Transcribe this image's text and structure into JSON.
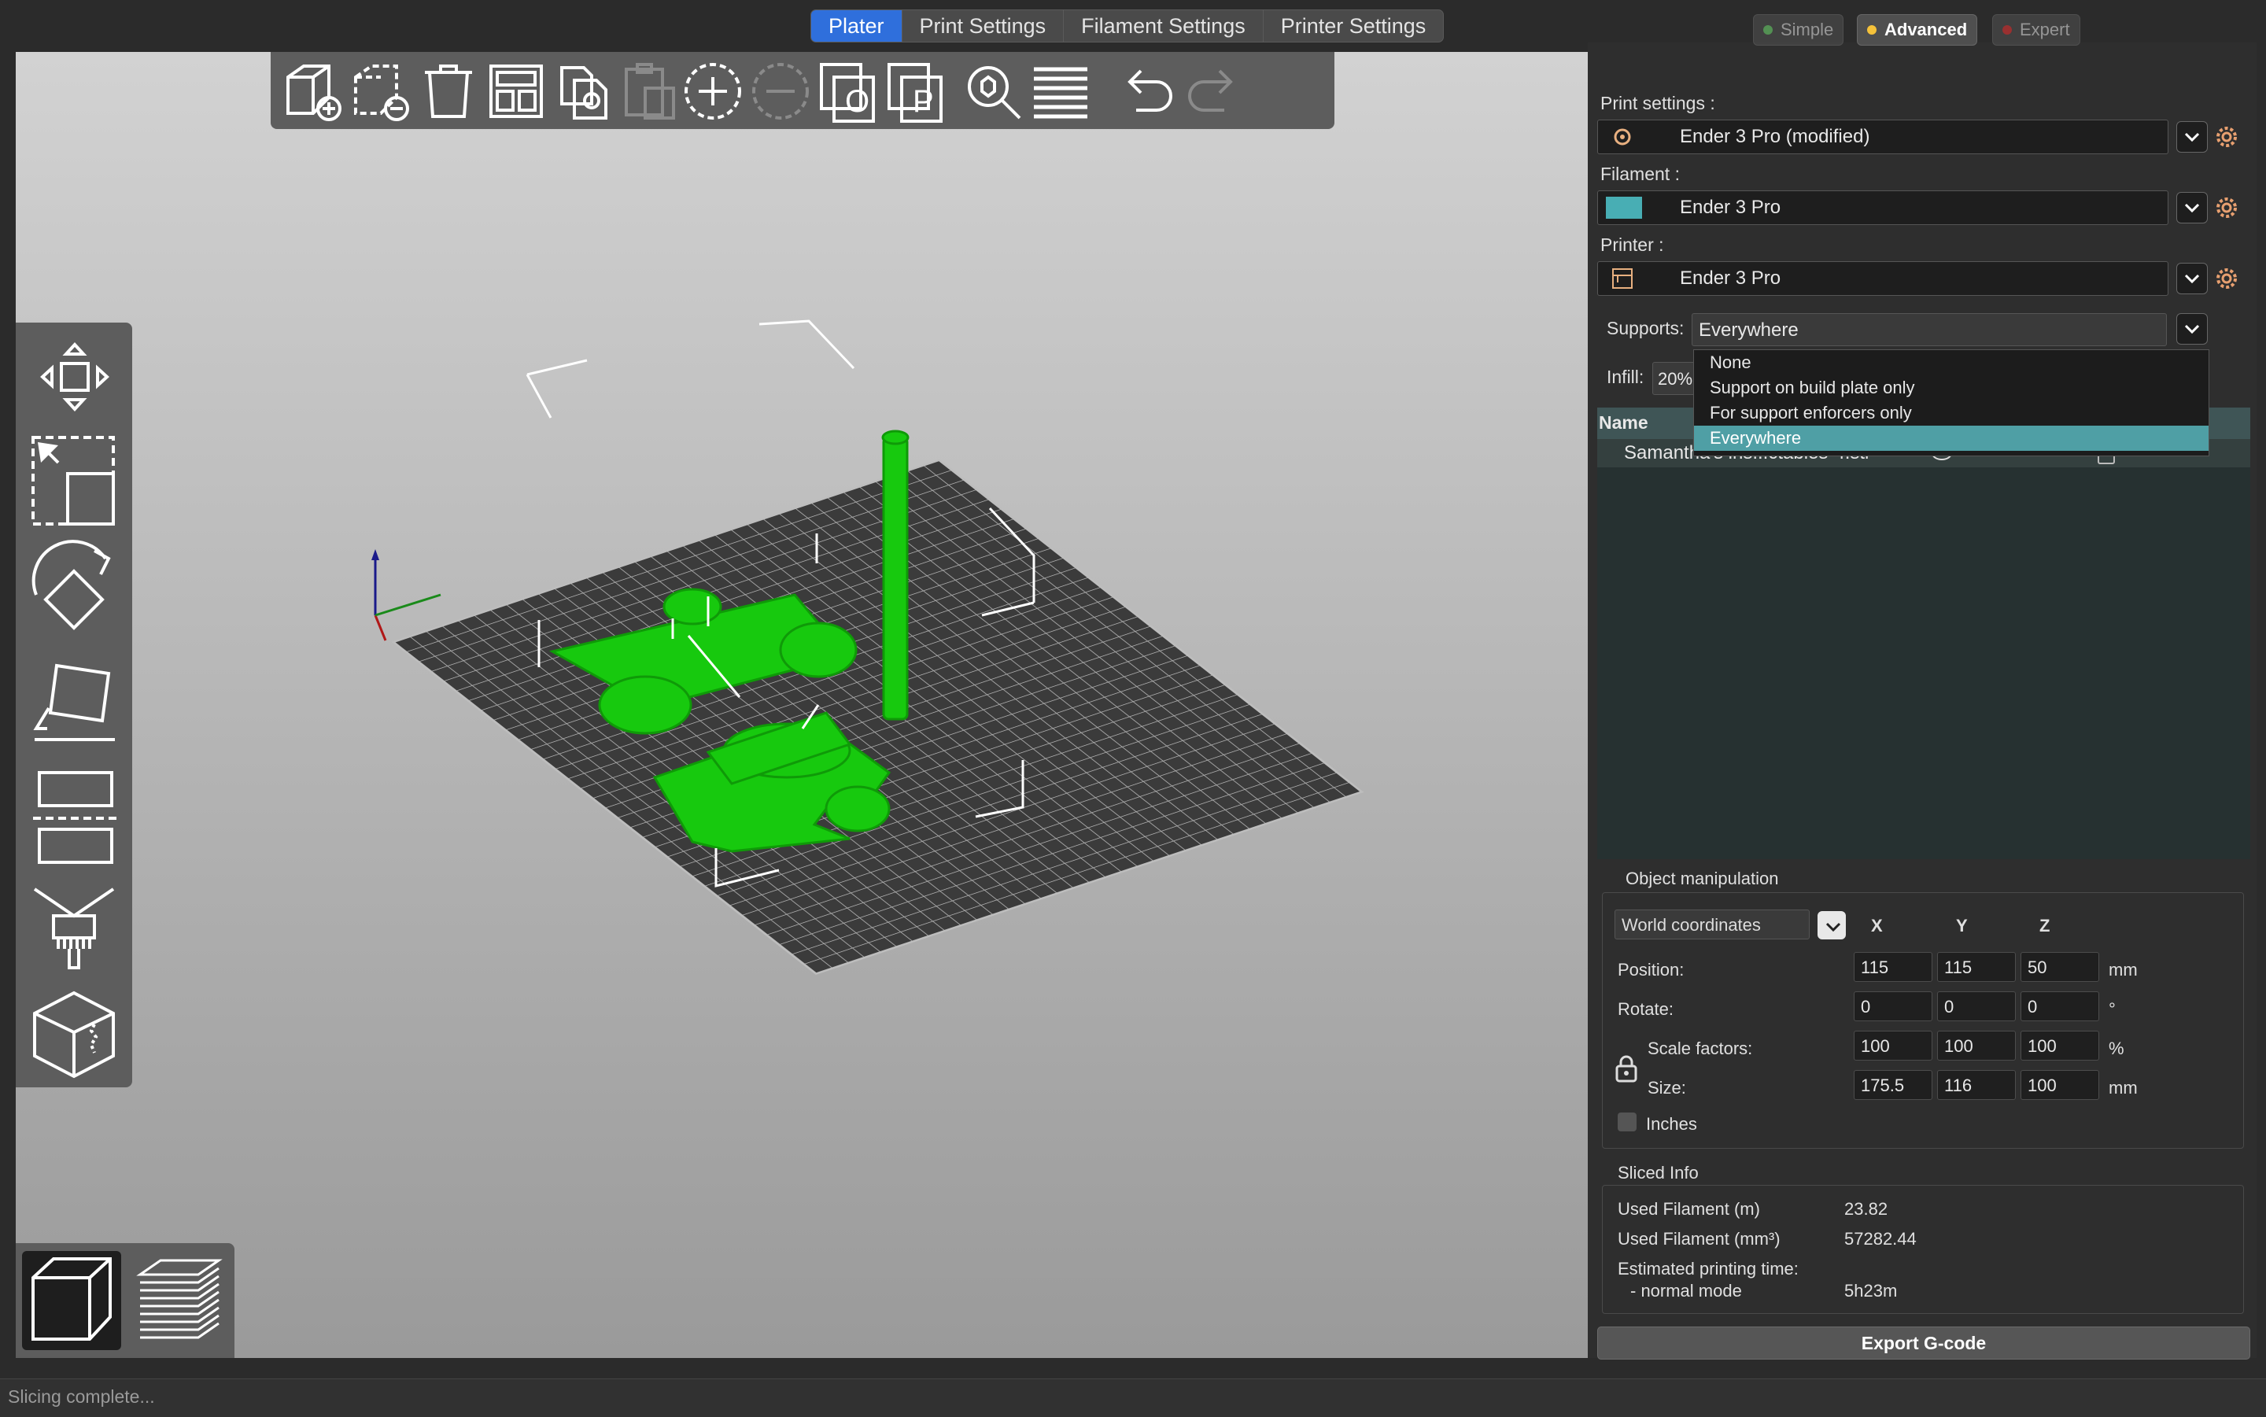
{
  "tabs": [
    "Plater",
    "Print Settings",
    "Filament Settings",
    "Printer Settings"
  ],
  "modes": {
    "simple": "Simple",
    "advanced": "Advanced",
    "expert": "Expert"
  },
  "colors": {
    "accent": "#2f6fdc",
    "selection": "#4f9fa5",
    "model": "#17c90e",
    "simple": "#6fd46f",
    "advanced": "#f5c23a",
    "expert": "#e23434",
    "filament": "#48aeb4"
  },
  "presets": {
    "print_label": "Print settings :",
    "print_value": "Ender 3 Pro (modified)",
    "filament_label": "Filament :",
    "filament_value": "Ender 3 Pro",
    "printer_label": "Printer :",
    "printer_value": "Ender 3 Pro"
  },
  "supports": {
    "label": "Supports:",
    "value": "Everywhere",
    "options": [
      "None",
      "Support on build plate only",
      "For support enforcers only",
      "Everywhere"
    ]
  },
  "infill": {
    "label": "Infill:",
    "value": "20%"
  },
  "object_list": {
    "header_name": "Name",
    "item": "Samantha's ins...ctables-4.stl"
  },
  "manip": {
    "title": "Object manipulation",
    "coords": "World coordinates",
    "x": "X",
    "y": "Y",
    "z": "Z",
    "position_label": "Position:",
    "position": [
      "115",
      "115",
      "50"
    ],
    "position_unit": "mm",
    "rotate_label": "Rotate:",
    "rotate": [
      "0",
      "0",
      "0"
    ],
    "rotate_unit": "°",
    "scale_label": "Scale factors:",
    "scale": [
      "100",
      "100",
      "100"
    ],
    "scale_unit": "%",
    "size_label": "Size:",
    "size": [
      "175.5",
      "116",
      "100"
    ],
    "size_unit": "mm",
    "inches": "Inches"
  },
  "sliced": {
    "title": "Sliced Info",
    "filament_m_label": "Used Filament (m)",
    "filament_m": "23.82",
    "filament_mm3_label": "Used Filament (mm³)",
    "filament_mm3": "57282.44",
    "time_label": "Estimated printing time:",
    "normal_label": "- normal mode",
    "normal": "5h23m"
  },
  "export": "Export G-code",
  "status": "Slicing complete..."
}
